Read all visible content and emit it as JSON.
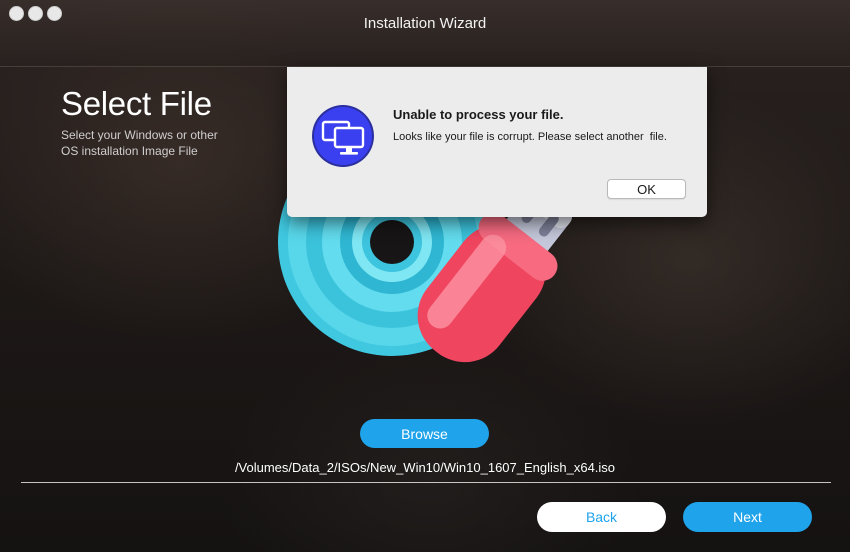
{
  "window": {
    "title": "Installation Wizard"
  },
  "page": {
    "heading": "Select File",
    "subheading": "Select your Windows or other OS installation Image File"
  },
  "artwork": {
    "icons": [
      "disc-icon",
      "usb-drive-icon"
    ],
    "colors": {
      "disc": "#4fd2e6",
      "usb_body": "#f0455f",
      "usb_connector": "#bfc3d6"
    }
  },
  "browse_button": {
    "label": "Browse"
  },
  "selected_file": {
    "path": "/Volumes/Data_2/ISOs/New_Win10/Win10_1607_English_x64.iso"
  },
  "navigation": {
    "back_label": "Back",
    "next_label": "Next"
  },
  "alert": {
    "icon": "app-monitors-icon",
    "title": "Unable to process your file.",
    "message": "Looks like your file is corrupt. Please select another  file.",
    "ok_label": "OK"
  },
  "colors": {
    "accent": "#1fa3ea",
    "alert_background": "#ececec"
  }
}
